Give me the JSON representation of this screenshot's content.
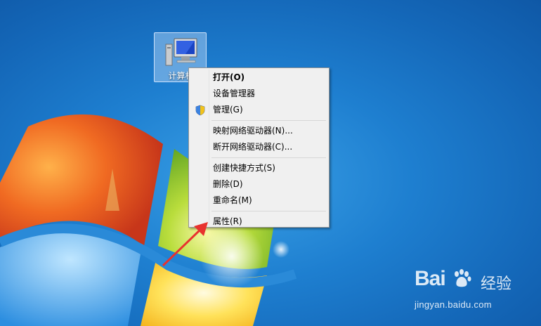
{
  "desktop": {
    "icon": {
      "label": "计算机",
      "icon": "computer-icon"
    }
  },
  "context_menu": {
    "items": [
      {
        "label": "打开(O)",
        "bold": true
      },
      {
        "label": "设备管理器"
      },
      {
        "label": "管理(G)",
        "icon": "uac-shield-icon"
      },
      {
        "separator": true
      },
      {
        "label": "映射网络驱动器(N)..."
      },
      {
        "label": "断开网络驱动器(C)..."
      },
      {
        "separator": true
      },
      {
        "label": "创建快捷方式(S)"
      },
      {
        "label": "删除(D)"
      },
      {
        "label": "重命名(M)"
      },
      {
        "separator": true
      },
      {
        "label": "属性(R)"
      }
    ]
  },
  "annotation": {
    "arrow_color": "#e8322e"
  },
  "watermark": {
    "brand": "Bai",
    "brand_suffix": "经验",
    "url": "jingyan.baidu.com"
  }
}
